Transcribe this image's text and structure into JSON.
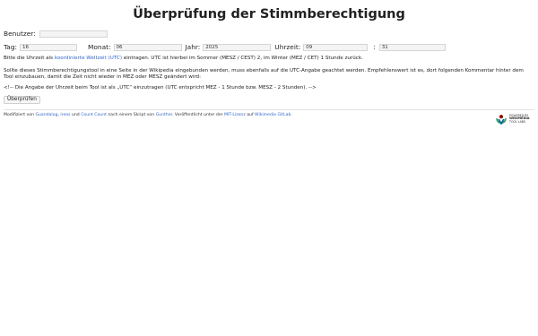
{
  "page": {
    "title": "Überprüfung der Stimmberechtigung"
  },
  "user": {
    "label": "Benutzer:",
    "value": ""
  },
  "date": {
    "day_label": "Tag:",
    "day_value": "16",
    "month_label": "Monat:",
    "month_value": "06",
    "year_label": "Jahr:",
    "year_value": "2025",
    "time_label": "Uhrzeit:",
    "hour_value": "09",
    "sep": ":",
    "minute_value": "31"
  },
  "info": {
    "line1_before": "Bitte die Uhrzeit als ",
    "line1_link": "koordinierte Weltzeit (UTC)",
    "line1_after": " eintragen. UTC ist hierbei im Sommer (MESZ / CEST) 2, im Winter (MEZ / CET) 1 Stunde zurück.",
    "paragraph2": "Sollte dieses Stimmberechtigungstool in eine Seite in der Wikipedia eingebunden werden, muss ebenfalls auf die UTC-Angabe geachtet werden. Empfehlenswert ist es, dort folgenden Kommentar hinter dem Tool einzubauen, damit die Zeit nicht wieder in MEZ oder MESZ geändert wird:",
    "comment": "<!-- Die Angabe der Uhrzeit beim Tool ist als „UTC“ einzutragen (UTC entspricht MEZ - 1 Stunde bzw. MESZ - 2 Stunden). -->"
  },
  "button": {
    "label": "Überprüfen"
  },
  "footer": {
    "t1": "Modifiziert von ",
    "l1": "Guandalug",
    "t2": ", ",
    "l2": "ireas",
    "t3": " und ",
    "l3": "Count Count",
    "t4": " nach einem Skript von ",
    "l4": "Gunther",
    "t5": ". Veröffentlicht unter der ",
    "l5": "MIT-Lizenz",
    "t6": " auf ",
    "l6": "Wikimedia GitLab",
    "t7": "."
  },
  "badge": {
    "line1": "POWERED BY",
    "line2": "WIKIMEDIA",
    "line3": "TOOL LABS",
    "colors": {
      "red": "#990000",
      "green": "#339966",
      "blue": "#006699"
    }
  },
  "colors": {
    "link": "#3366cc"
  }
}
